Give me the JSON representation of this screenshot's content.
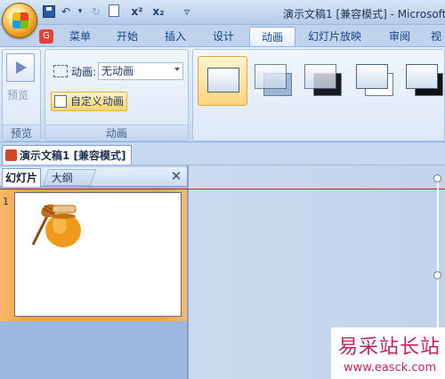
{
  "window": {
    "title": "演示文稿1 [兼容模式] - Microsoft"
  },
  "quick_access": {
    "undo": "↶",
    "redo": "↻",
    "superscript": "x²",
    "subscript": "x₂",
    "more": "▿"
  },
  "ribbon_tabs": [
    {
      "label": "菜单",
      "active": false
    },
    {
      "label": "开始",
      "active": false
    },
    {
      "label": "插入",
      "active": false
    },
    {
      "label": "设计",
      "active": false
    },
    {
      "label": "动画",
      "active": true
    },
    {
      "label": "幻灯片放映",
      "active": false
    },
    {
      "label": "审阅",
      "active": false
    },
    {
      "label": "视",
      "active": false
    }
  ],
  "addin_icon_text": "G",
  "groups": {
    "preview": {
      "button_label": "预览",
      "group_label": "预览"
    },
    "animation": {
      "anim_label": "动画:",
      "anim_value": "无动画",
      "custom_button": "自定义动画",
      "group_label": "动画"
    }
  },
  "document_tab": {
    "title": "演示文稿1 [兼容模式]"
  },
  "pane": {
    "tabs": [
      {
        "label": "幻灯片",
        "active": true
      },
      {
        "label": "大纲",
        "active": false
      }
    ],
    "close_glyph": "✕",
    "slides": [
      {
        "number": "1",
        "content": "honey-jar-image"
      }
    ]
  },
  "watermark": {
    "text": "易采站长站",
    "url": "www.easck.com"
  },
  "colors": {
    "selection_accent": "#f0a048",
    "ribbon_bg": "#d3e2f5",
    "watermark": "#c4235a"
  }
}
